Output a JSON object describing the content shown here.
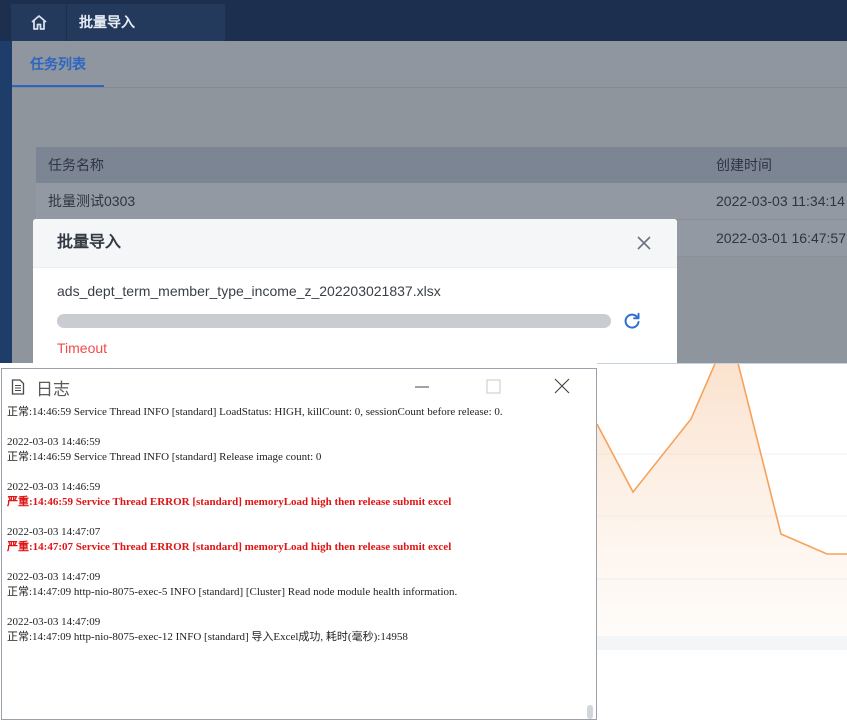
{
  "app": {
    "breadcrumb_tab": "批量导入",
    "subtab": "任务列表",
    "grid": {
      "headers": [
        "任务名称",
        "创建时间"
      ],
      "rows": [
        [
          "批量测试0303",
          "2022-03-03 11:34:14"
        ],
        [
          "",
          "2022-03-01 16:47:57"
        ]
      ]
    }
  },
  "modal": {
    "title": "批量导入",
    "file_name": "ads_dept_term_member_type_income_z_202203021837.xlsx",
    "progress": 1.0,
    "status": "Timeout",
    "status_color": "#f24b4b"
  },
  "log_window": {
    "title": "日志",
    "entries": [
      {
        "time": "",
        "text": "正常:14:46:59 Service Thread INFO [standard] LoadStatus: HIGH, killCount: 0, sessionCount before release: 0.",
        "level": "info"
      },
      {
        "time": "2022-03-03 14:46:59",
        "text": "正常:14:46:59 Service Thread INFO [standard] Release image count: 0",
        "level": "info"
      },
      {
        "time": "2022-03-03 14:46:59",
        "text": "严重:14:46:59 Service Thread ERROR [standard] memoryLoad high then release submit excel",
        "level": "error"
      },
      {
        "time": "2022-03-03 14:47:07",
        "text": "严重:14:47:07 Service Thread ERROR [standard] memoryLoad high then release submit excel",
        "level": "error"
      },
      {
        "time": "2022-03-03 14:47:09",
        "text": "正常:14:47:09 http-nio-8075-exec-5 INFO [standard] [Cluster] Read node module health information.",
        "level": "info"
      },
      {
        "time": "2022-03-03 14:47:09",
        "text": "正常:14:47:09 http-nio-8075-exec-12 INFO [standard] 导入Excel成功, 耗时(毫秒):14958",
        "level": "info"
      }
    ]
  },
  "colors": {
    "topbar": "#1c2f4e",
    "accent": "#2d66c1",
    "error_text": "#e01414",
    "chart_line": "#f5a25d"
  },
  "icons": [
    "home-icon",
    "close-icon",
    "refresh-icon",
    "document-icon",
    "minimize-icon",
    "maximize-icon",
    "window-close-icon"
  ]
}
